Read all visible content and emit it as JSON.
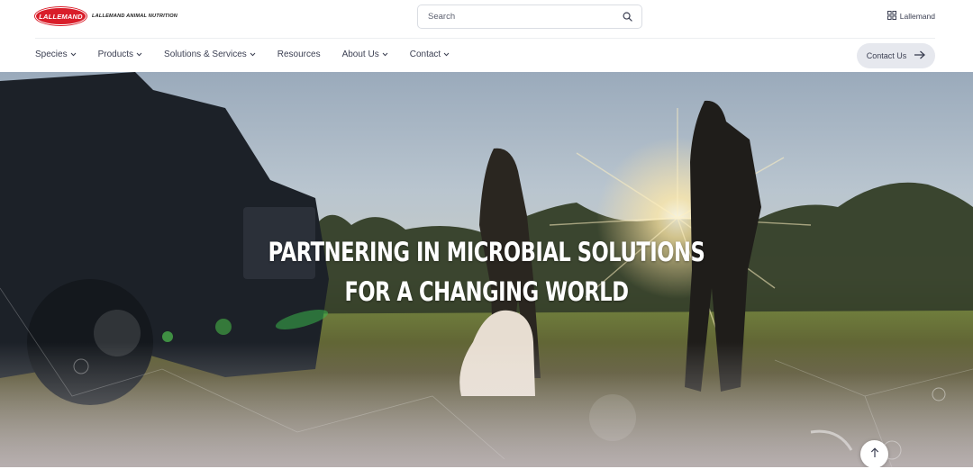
{
  "brand": {
    "logo_text": "LALLEMAND",
    "subtitle": "LALLEMAND ANIMAL NUTRITION",
    "accent_color": "#d91e2a"
  },
  "search": {
    "placeholder": "Search",
    "icon": "search-icon"
  },
  "brand_switch": {
    "label": "Lallemand",
    "icon": "grid-icon"
  },
  "nav": {
    "items": [
      {
        "label": "Species",
        "has_dropdown": true
      },
      {
        "label": "Products",
        "has_dropdown": true
      },
      {
        "label": "Solutions & Services",
        "has_dropdown": true
      },
      {
        "label": "Resources",
        "has_dropdown": false
      },
      {
        "label": "About Us",
        "has_dropdown": true
      },
      {
        "label": "Contact",
        "has_dropdown": true
      }
    ],
    "cta_label": "Contact Us",
    "cta_icon": "arrow-right-icon"
  },
  "hero": {
    "headline_line1": "PARTNERING IN MICROBIAL SOLUTIONS",
    "headline_line2": "FOR A CHANGING WORLD",
    "scroll_icon": "arrow-up-icon"
  }
}
